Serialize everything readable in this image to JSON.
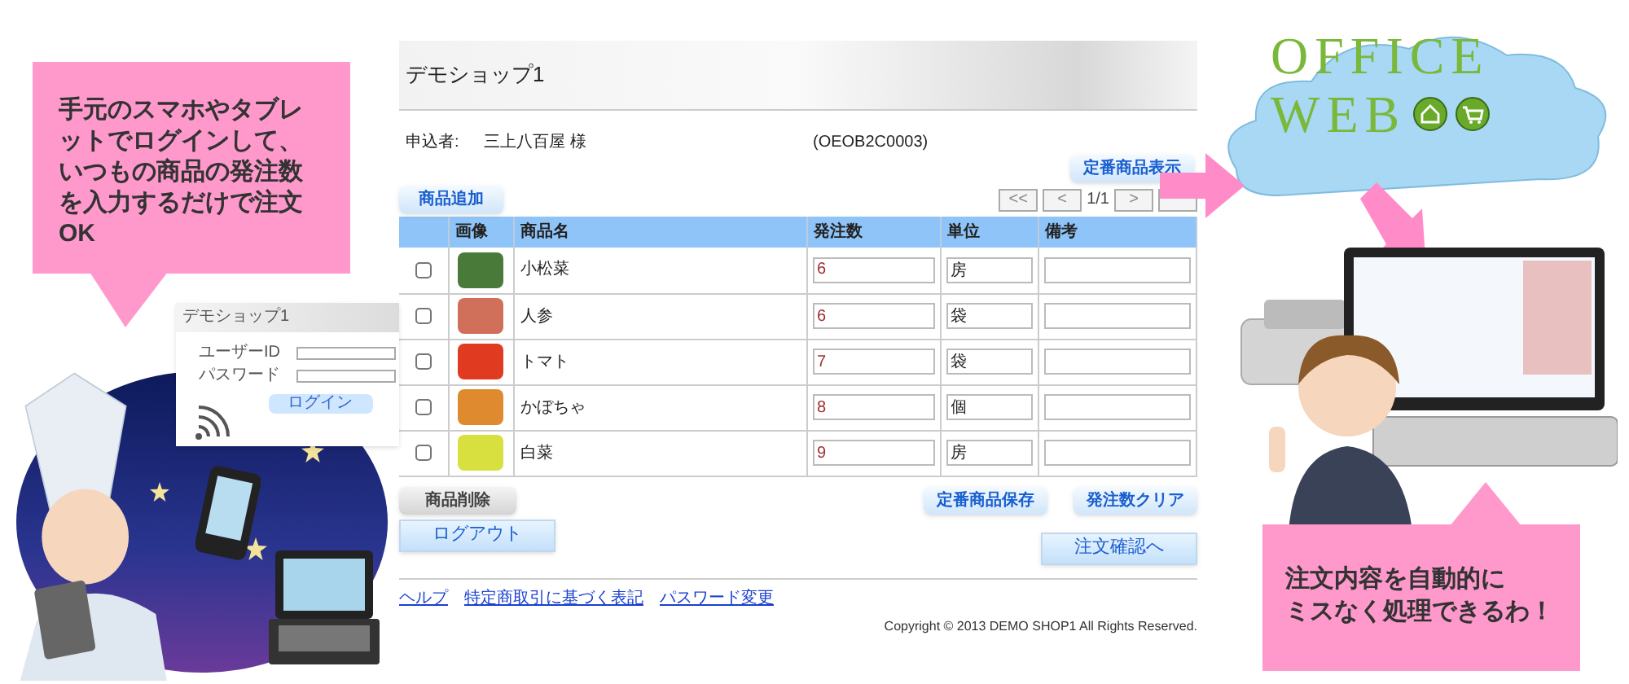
{
  "left_callout": {
    "text": "手元のスマホやタブレットでログインして、いつもの商品の発注数を入力するだけで注文OK"
  },
  "login_preview": {
    "title": "デモショップ1",
    "user_label": "ユーザーID",
    "password_label": "パスワード",
    "login_button": "ログイン"
  },
  "page": {
    "title": "デモショップ1",
    "applicant_label": "申込者:",
    "applicant_name": "三上八百屋 様",
    "code": "(OEOB2C0003)",
    "show_favorites_button": "定番商品表示",
    "add_button": "商品追加",
    "pager": {
      "first": "<<",
      "prev": "<",
      "page": "1/1",
      "next": ">"
    },
    "table": {
      "columns": [
        "画像",
        "商品名",
        "発注数",
        "単位",
        "備考"
      ],
      "rows": [
        {
          "checked": false,
          "color": "#4a7a3a",
          "name": "小松菜",
          "quantity": "6",
          "unit": "房"
        },
        {
          "checked": false,
          "color": "#d0705a",
          "name": "人参",
          "quantity": "6",
          "unit": "袋"
        },
        {
          "checked": false,
          "color": "#e03a20",
          "name": "トマト",
          "quantity": "7",
          "unit": "袋"
        },
        {
          "checked": false,
          "color": "#e08a30",
          "name": "かぼちゃ",
          "quantity": "8",
          "unit": "個"
        },
        {
          "checked": false,
          "color": "#d8e040",
          "name": "白菜",
          "quantity": "9",
          "unit": "房"
        }
      ]
    },
    "delete_button": "商品削除",
    "save_favorites_button": "定番商品保存",
    "clear_quantities_button": "発注数クリア",
    "logout_button": "ログアウト",
    "confirm_button": "注文確認へ",
    "links": [
      "ヘルプ",
      "特定商取引に基づく表記",
      "パスワード変更"
    ],
    "copyright": "Copyright © 2013 DEMO SHOP1 All Rights Reserved."
  },
  "logo": {
    "line_1": "OFFICE",
    "line_2": "WEB"
  },
  "right_callout": {
    "lines": [
      "注文内容を自動的に",
      "ミスなく処理できるわ！"
    ]
  }
}
